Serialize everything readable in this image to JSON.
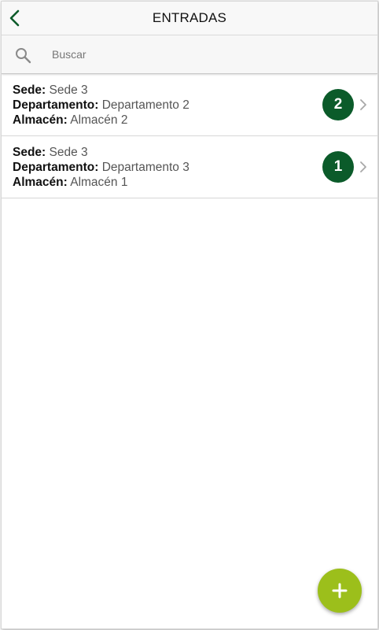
{
  "header": {
    "title": "ENTRADAS",
    "back_icon": "chevron-left-icon"
  },
  "search": {
    "placeholder": "Buscar",
    "icon": "search-icon"
  },
  "labels": {
    "sede": "Sede:",
    "departamento": "Departamento:",
    "almacen": "Almacén:"
  },
  "entries": [
    {
      "sede": "Sede 3",
      "departamento": "Departamento 2",
      "almacen": "Almacén 2",
      "count": "2"
    },
    {
      "sede": "Sede 3",
      "departamento": "Departamento 3",
      "almacen": "Almacén 1",
      "count": "1"
    }
  ],
  "fab": {
    "icon": "plus-icon"
  },
  "colors": {
    "back_icon": "#0b5b2a",
    "badge": "#0b5b2a",
    "fab": "#9cbf1b"
  }
}
